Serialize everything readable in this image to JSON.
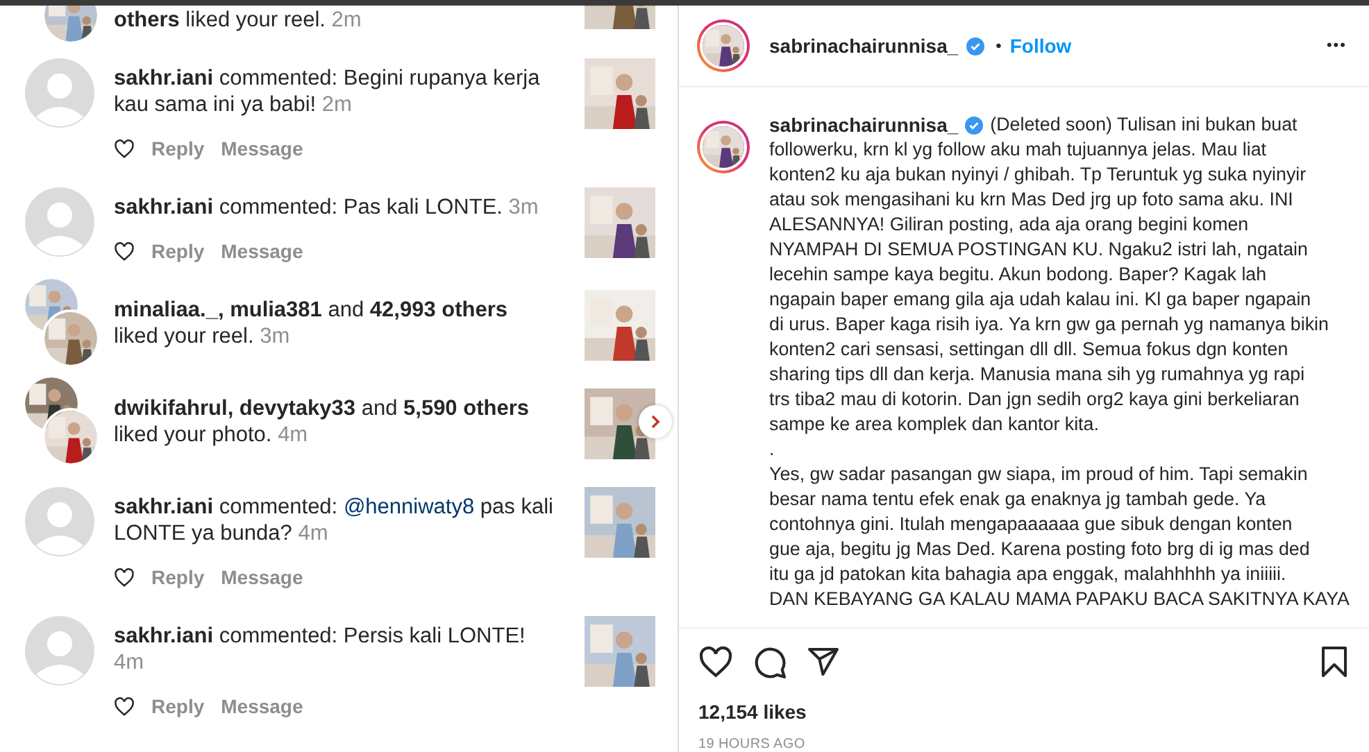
{
  "notifications": [
    {
      "kind": "like",
      "text": "**others** liked your reel.",
      "time": "2m",
      "has_next": false
    },
    {
      "kind": "comment",
      "text": "**sakhr.iani** commented: Begini rupanya kerja kau sama ini ya babi!",
      "time": "2m",
      "actions": [
        "Reply",
        "Message"
      ],
      "has_next": false
    },
    {
      "kind": "comment",
      "text": "**sakhr.iani** commented: Pas kali LONTE.",
      "time": "3m",
      "actions": [
        "Reply",
        "Message"
      ],
      "has_next": false
    },
    {
      "kind": "like",
      "text": "**minaliaa._, mulia381** and **42,993 others** liked your reel.",
      "time": "3m",
      "has_next": false
    },
    {
      "kind": "like",
      "text": "**dwikifahrul, devytaky33** and **5,590 others** liked your photo.",
      "time": "4m",
      "has_next": true
    },
    {
      "kind": "comment",
      "text": "**sakhr.iani** commented:",
      "mention": "@henniwaty8",
      "text_after": "pas kali LONTE ya bunda?",
      "time": "4m",
      "actions": [
        "Reply",
        "Message"
      ],
      "has_next": false
    },
    {
      "kind": "comment",
      "text": "**sakhr.iani** commented: Persis kali LONTE!",
      "time": "4m",
      "actions": [
        "Reply",
        "Message"
      ],
      "has_next": false
    }
  ],
  "post": {
    "username": "sabrinachairunnisa_",
    "caption_username": "sabrinachairunnisa_",
    "verified": true,
    "separator": "•",
    "follow": "Follow",
    "more": "•••",
    "caption_lines": [
      "(Deleted soon) Tulisan ini bukan buat",
      "followerku, krn kl yg follow aku mah tujuannya jelas. Mau liat",
      "konten2 ku aja bukan nyinyi / ghibah. Tp Teruntuk yg suka nyinyir",
      "atau sok mengasihani ku krn Mas Ded jrg up foto sama aku. INI",
      "ALESANNYA! Giliran posting, ada aja orang begini komen",
      "NYAMPAH DI SEMUA POSTINGAN KU. Ngaku2 istri lah, ngatain",
      "lecehin sampe kaya begitu. Akun bodong. Baper? Kagak lah",
      "ngapain baper emang gila aja udah kalau ini. Kl ga baper ngapain",
      "di urus. Baper kaga risih iya. Ya krn gw ga pernah yg namanya bikin",
      "konten2 cari sensasi, settingan dll dll. Semua fokus dgn konten",
      "sharing tips dll dan kerja. Manusia mana sih yg rumahnya yg rapi",
      "trs tiba2 mau di kotorin. Dan jgn sedih org2 kaya gini berkeliaran",
      "sampe ke area komplek dan kantor kita.",
      ".",
      "Yes, gw sadar pasangan gw siapa, im proud of him. Tapi semakin",
      "besar nama tentu efek enak ga enaknya jg tambah gede. Ya",
      "contohnya gini. Itulah mengapaaaaaa gue sibuk dengan konten",
      "gue aja, begitu jg Mas Ded. Karena posting foto brg di ig mas ded",
      "itu ga jd patokan kita bahagia apa enggak, malahhhhh ya iniiiii.",
      "DAN KEBAYANG GA KALAU MAMA PAPAKU BACA SAKITNYA KAYA"
    ],
    "liked": false,
    "saved": false,
    "likes": "12,154 likes",
    "time_ago": "19 HOURS AGO"
  }
}
